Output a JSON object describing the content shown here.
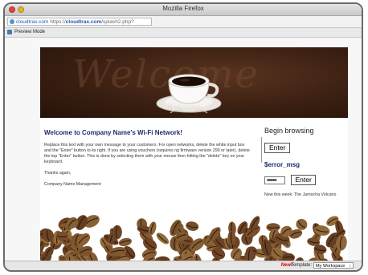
{
  "window": {
    "title": "Mozilla Firefox"
  },
  "url": {
    "host": "cloudtrax.com",
    "prefix": "https://",
    "host_bold": "cloudtrax.com",
    "path": "/splash2.php?"
  },
  "toolbar": {
    "preview_mode_label": "Preview Mode"
  },
  "banner": {
    "background_word": "Welcome",
    "script_word": "Welcome"
  },
  "main": {
    "heading": "Welcome to Company Name's Wi-Fi Network!",
    "paragraph1": "Replace this text with your own message to your customers. For open networks, delete the white input box and the \"Enter\" button to its right. If you are using vouchers (requires ng firmware version 299 or later), delete the top \"Enter\" button. This is done by selecting them with your mouse then hitting the \"delete\" key on your keyboard.",
    "paragraph2": "Thanks again,",
    "paragraph3": "Company Name Management"
  },
  "sidebar": {
    "begin_label": "Begin browsing",
    "enter_label_1": "Enter",
    "error_msg": "$error_msg",
    "password_mask": "••••••••",
    "enter_label_2": "Enter",
    "new_this_week": "New this week: The Jamocha Volcano"
  },
  "statusbar": {
    "new_label": "New!",
    "template_label": "Template:",
    "template_value": "My Workspace",
    "select_arrow": "↕"
  },
  "colors": {
    "heading": "#1c2b6e",
    "banner": "#3a1f12",
    "new_badge": "#dd0000"
  }
}
